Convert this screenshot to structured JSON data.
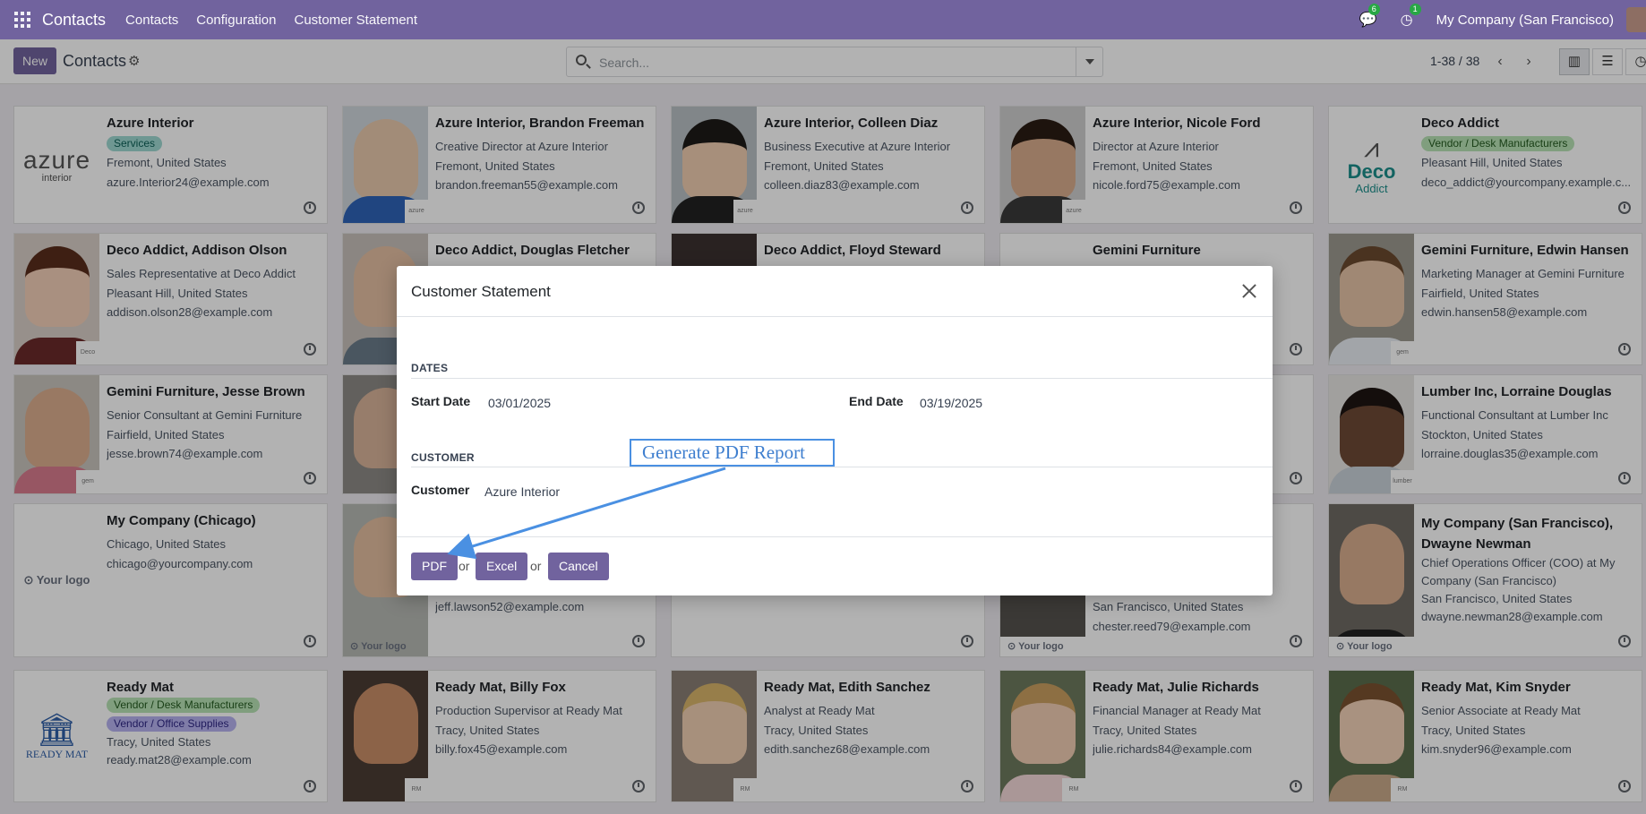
{
  "navbar": {
    "brand": "Contacts",
    "links": [
      "Contacts",
      "Configuration",
      "Customer Statement"
    ],
    "chat_badge": "6",
    "activity_badge": "1",
    "company": "My Company (San Francisco)"
  },
  "control_panel": {
    "new_label": "New",
    "title": "Contacts",
    "search_placeholder": "Search...",
    "pager": "1-38 / 38",
    "prev": "‹",
    "next": "›"
  },
  "cards": [
    {
      "name": "Azure Interior",
      "tags": [
        "Services"
      ],
      "lines": [
        "Fremont, United States",
        "azure.Interior24@example.com"
      ]
    },
    {
      "name": "Azure Interior, Brandon Freeman",
      "lines": [
        "Creative Director at Azure Interior",
        "Fremont, United States",
        "brandon.freeman55@example.com"
      ]
    },
    {
      "name": "Azure Interior, Colleen Diaz",
      "lines": [
        "Business Executive at Azure Interior",
        "Fremont, United States",
        "colleen.diaz83@example.com"
      ]
    },
    {
      "name": "Azure Interior, Nicole Ford",
      "lines": [
        "Director at Azure Interior",
        "Fremont, United States",
        "nicole.ford75@example.com"
      ]
    },
    {
      "name": "Deco Addict",
      "tags": [
        "Vendor / Desk Manufacturers"
      ],
      "lines": [
        "Pleasant Hill, United States",
        "deco_addict@yourcompany.example.c..."
      ]
    },
    {
      "name": "Deco Addict, Addison Olson",
      "lines": [
        "Sales Representative at Deco Addict",
        "Pleasant Hill, United States",
        "addison.olson28@example.com"
      ]
    },
    {
      "name": "Deco Addict, Douglas Fletcher",
      "lines": []
    },
    {
      "name": "Deco Addict, Floyd Steward",
      "lines": []
    },
    {
      "name": "Gemini Furniture",
      "lines": []
    },
    {
      "name": "Gemini Furniture, Edwin Hansen",
      "lines": [
        "Marketing Manager at Gemini Furniture",
        "Fairfield, United States",
        "edwin.hansen58@example.com"
      ]
    },
    {
      "name": "Gemini Furniture, Jesse Brown",
      "lines": [
        "Senior Consultant at Gemini Furniture",
        "Fairfield, United States",
        "jesse.brown74@example.com"
      ]
    },
    {
      "name": "",
      "lines": []
    },
    {
      "name": "",
      "lines": []
    },
    {
      "name": "",
      "lines": []
    },
    {
      "name": "Lumber Inc, Lorraine Douglas",
      "lines": [
        "Functional Consultant at Lumber Inc",
        "Stockton, United States",
        "lorraine.douglas35@example.com"
      ]
    },
    {
      "name": "My Company (Chicago)",
      "lines": [
        "Chicago, United States",
        "chicago@yourcompany.com"
      ]
    },
    {
      "name": "",
      "lines": [
        "jeff.lawson52@example.com"
      ]
    },
    {
      "name": "",
      "lines": []
    },
    {
      "name": "",
      "lines": [
        "San Francisco, United States",
        "chester.reed79@example.com"
      ]
    },
    {
      "name": "My Company (San Francisco), Dwayne Newman",
      "lines": [
        "Chief Operations Officer (COO) at My Company (San Francisco)",
        "San Francisco, United States",
        "dwayne.newman28@example.com"
      ]
    },
    {
      "name": "Ready Mat",
      "tags": [
        "Vendor / Desk Manufacturers",
        "Vendor / Office Supplies"
      ],
      "lines": [
        "Tracy, United States",
        "ready.mat28@example.com"
      ]
    },
    {
      "name": "Ready Mat, Billy Fox",
      "lines": [
        "Production Supervisor at Ready Mat",
        "Tracy, United States",
        "billy.fox45@example.com"
      ]
    },
    {
      "name": "Ready Mat, Edith Sanchez",
      "lines": [
        "Analyst at Ready Mat",
        "Tracy, United States",
        "edith.sanchez68@example.com"
      ]
    },
    {
      "name": "Ready Mat, Julie Richards",
      "lines": [
        "Financial Manager at Ready Mat",
        "Tracy, United States",
        "julie.richards84@example.com"
      ]
    },
    {
      "name": "Ready Mat, Kim Snyder",
      "lines": [
        "Senior Associate at Ready Mat",
        "Tracy, United States",
        "kim.snyder96@example.com"
      ]
    }
  ],
  "logos": {
    "azure_main": "azure",
    "azure_sub": "interior",
    "deco_main": "Deco",
    "deco_sub": "Addict",
    "ready_mat": "READY MAT",
    "your_logo": "Your logo"
  },
  "dialog": {
    "title": "Customer Statement",
    "dates_section": "DATES",
    "start_label": "Start Date",
    "start_value": "03/01/2025",
    "end_label": "End Date",
    "end_value": "03/19/2025",
    "customer_section": "CUSTOMER",
    "customer_label": "Customer",
    "customer_value": "Azure Interior",
    "pdf_label": "PDF",
    "excel_label": "Excel",
    "cancel_label": "Cancel",
    "or": "or"
  },
  "annotation": {
    "text": "Generate PDF Report",
    "color": "#4a90e2"
  },
  "colors": {
    "brand": "#71639e"
  }
}
